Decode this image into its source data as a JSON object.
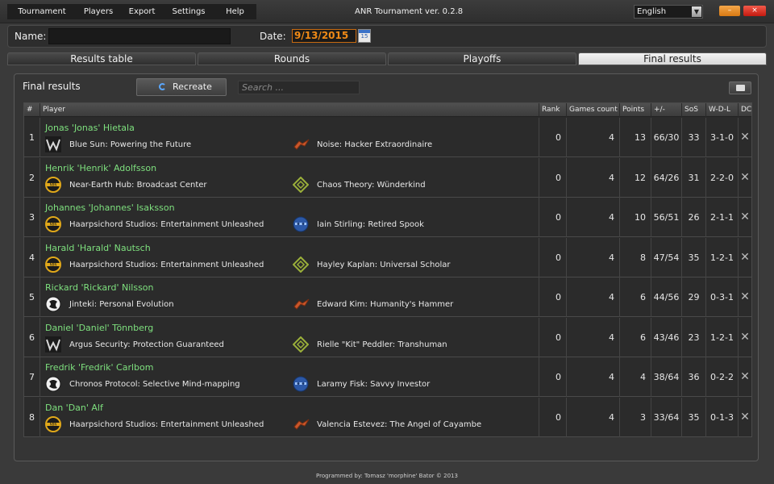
{
  "menu": [
    "Tournament",
    "Players",
    "Export",
    "Settings",
    "Help"
  ],
  "app_title": "ANR Tournament ver. 0.2.8",
  "language": "English",
  "window_buttons": {
    "minimize": "–",
    "close": "×"
  },
  "info": {
    "name_label": "Name:",
    "name_value": "",
    "date_label": "Date:",
    "date_value": "9/13/2015",
    "calendar_text": "15"
  },
  "tabs": [
    "Results table",
    "Rounds",
    "Playoffs",
    "Final results"
  ],
  "panel": {
    "title": "Final results",
    "recreate_label": "Recreate",
    "search_placeholder": "Search ..."
  },
  "columns": [
    "#",
    "Player",
    "Rank",
    "Games count",
    "Points",
    "+/-",
    "SoS",
    "W-D-L",
    "DC"
  ],
  "rows": [
    {
      "idx": "1",
      "player": "Jonas 'Jonas' Hietala",
      "corp_icon": "weyland",
      "corp": "Blue Sun: Powering the Future",
      "runner_icon": "anarch",
      "runner": "Noise: Hacker Extraordinaire",
      "rank": "0",
      "games": "4",
      "points": "13",
      "diff": "66/30",
      "sos": "33",
      "wdl": "3-1-0",
      "dc": "✕"
    },
    {
      "idx": "2",
      "player": "Henrik 'Henrik' Adolfsson",
      "corp_icon": "nbn",
      "corp": "Near-Earth Hub: Broadcast Center",
      "runner_icon": "shaper",
      "runner": "Chaos Theory: Wünderkind",
      "rank": "0",
      "games": "4",
      "points": "12",
      "diff": "64/26",
      "sos": "31",
      "wdl": "2-2-0",
      "dc": "✕"
    },
    {
      "idx": "3",
      "player": "Johannes 'Johannes' Isaksson",
      "corp_icon": "nbn",
      "corp": "Haarpsichord Studios: Entertainment Unleashed",
      "runner_icon": "criminal",
      "runner": "Iain Stirling: Retired Spook",
      "rank": "0",
      "games": "4",
      "points": "10",
      "diff": "56/51",
      "sos": "26",
      "wdl": "2-1-1",
      "dc": "✕"
    },
    {
      "idx": "4",
      "player": "Harald 'Harald' Nautsch",
      "corp_icon": "nbn",
      "corp": "Haarpsichord Studios: Entertainment Unleashed",
      "runner_icon": "shaper",
      "runner": "Hayley Kaplan: Universal Scholar",
      "rank": "0",
      "games": "4",
      "points": "8",
      "diff": "47/54",
      "sos": "35",
      "wdl": "1-2-1",
      "dc": "✕"
    },
    {
      "idx": "5",
      "player": "Rickard 'Rickard' Nilsson",
      "corp_icon": "jinteki",
      "corp": "Jinteki: Personal Evolution",
      "runner_icon": "anarch",
      "runner": "Edward Kim: Humanity's Hammer",
      "rank": "0",
      "games": "4",
      "points": "6",
      "diff": "44/56",
      "sos": "29",
      "wdl": "0-3-1",
      "dc": "✕"
    },
    {
      "idx": "6",
      "player": "Daniel 'Daniel' Tönnberg",
      "corp_icon": "weyland",
      "corp": "Argus Security: Protection Guaranteed",
      "runner_icon": "shaper",
      "runner": "Rielle \"Kit\" Peddler: Transhuman",
      "rank": "0",
      "games": "4",
      "points": "6",
      "diff": "43/46",
      "sos": "23",
      "wdl": "1-2-1",
      "dc": "✕"
    },
    {
      "idx": "7",
      "player": "Fredrik 'Fredrik' Carlbom",
      "corp_icon": "jinteki",
      "corp": "Chronos Protocol: Selective Mind-mapping",
      "runner_icon": "criminal",
      "runner": "Laramy Fisk: Savvy Investor",
      "rank": "0",
      "games": "4",
      "points": "4",
      "diff": "38/64",
      "sos": "36",
      "wdl": "0-2-2",
      "dc": "✕"
    },
    {
      "idx": "8",
      "player": "Dan 'Dan' Alf",
      "corp_icon": "nbn",
      "corp": "Haarpsichord Studios: Entertainment Unleashed",
      "runner_icon": "anarch",
      "runner": "Valencia Estevez: The Angel of Cayambe",
      "rank": "0",
      "games": "4",
      "points": "3",
      "diff": "33/64",
      "sos": "35",
      "wdl": "0-1-3",
      "dc": "✕"
    }
  ],
  "footer": "Programmed by: Tomasz 'morphine' Bator © 2013",
  "colors": {
    "accent": "#f08a16",
    "player_name": "#7ee07e",
    "close": "#d52a1c",
    "minimize": "#e5901f"
  }
}
